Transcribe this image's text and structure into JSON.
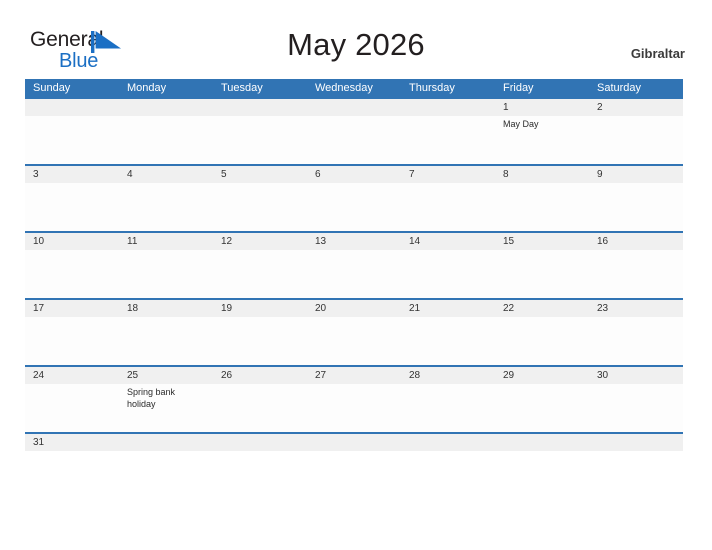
{
  "brand": {
    "name_part1": "General",
    "name_part2": "Blue",
    "flag_icon": "blue-triangle-flag-icon",
    "color_dark": "#231f20",
    "color_blue": "#1b6fc4"
  },
  "header": {
    "title": "May 2026",
    "location": "Gibraltar"
  },
  "theme": {
    "header_blue": "#3174b4",
    "row_divider_blue": "#3174b4",
    "date_band_gray": "#f0f0f0",
    "body_white": "#fdfdfd",
    "text_dark": "#333333"
  },
  "calendar": {
    "month": "May",
    "year": "2026",
    "weekday_headers": [
      "Sunday",
      "Monday",
      "Tuesday",
      "Wednesday",
      "Thursday",
      "Friday",
      "Saturday"
    ],
    "weeks": [
      {
        "dates": [
          "",
          "",
          "",
          "",
          "",
          "1",
          "2"
        ],
        "events": [
          "",
          "",
          "",
          "",
          "",
          "May Day",
          ""
        ]
      },
      {
        "dates": [
          "3",
          "4",
          "5",
          "6",
          "7",
          "8",
          "9"
        ],
        "events": [
          "",
          "",
          "",
          "",
          "",
          "",
          ""
        ]
      },
      {
        "dates": [
          "10",
          "11",
          "12",
          "13",
          "14",
          "15",
          "16"
        ],
        "events": [
          "",
          "",
          "",
          "",
          "",
          "",
          ""
        ]
      },
      {
        "dates": [
          "17",
          "18",
          "19",
          "20",
          "21",
          "22",
          "23"
        ],
        "events": [
          "",
          "",
          "",
          "",
          "",
          "",
          ""
        ]
      },
      {
        "dates": [
          "24",
          "25",
          "26",
          "27",
          "28",
          "29",
          "30"
        ],
        "events": [
          "",
          "Spring bank holiday",
          "",
          "",
          "",
          "",
          ""
        ]
      },
      {
        "dates": [
          "31",
          "",
          "",
          "",
          "",
          "",
          ""
        ],
        "events": [
          "",
          "",
          "",
          "",
          "",
          "",
          ""
        ]
      }
    ]
  }
}
